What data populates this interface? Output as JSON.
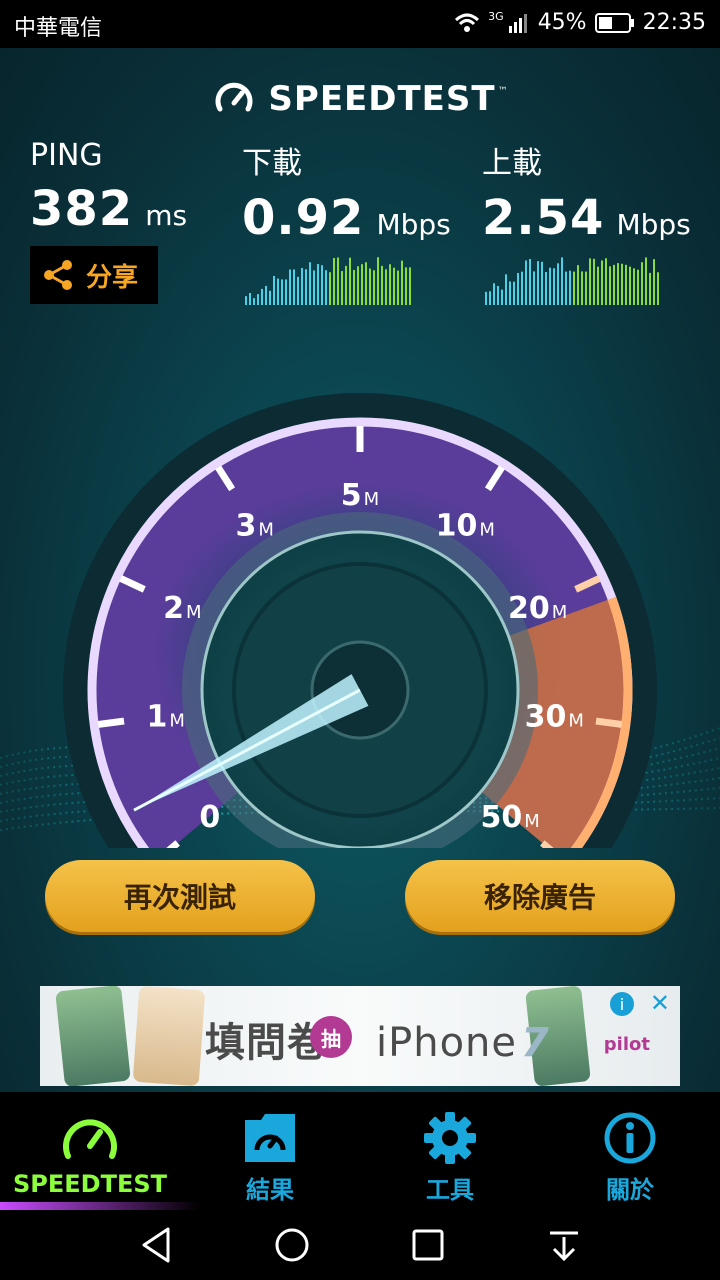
{
  "status_bar": {
    "carrier": "中華電信",
    "network": "3G",
    "battery": "45%",
    "time": "22:35"
  },
  "header": {
    "title": "SPEEDTEST",
    "tm": "™"
  },
  "metrics": {
    "ping": {
      "label": "PING",
      "value": "382",
      "unit": "ms"
    },
    "download": {
      "label": "下載",
      "value": "0.92",
      "unit": "Mbps"
    },
    "upload": {
      "label": "上載",
      "value": "2.54",
      "unit": "Mbps"
    }
  },
  "share": {
    "label": "分享"
  },
  "gauge": {
    "ticks": [
      {
        "num": "0",
        "suffix": ""
      },
      {
        "num": "1",
        "suffix": "M"
      },
      {
        "num": "2",
        "suffix": "M"
      },
      {
        "num": "3",
        "suffix": "M"
      },
      {
        "num": "5",
        "suffix": "M"
      },
      {
        "num": "10",
        "suffix": "M"
      },
      {
        "num": "20",
        "suffix": "M"
      },
      {
        "num": "30",
        "suffix": "M"
      },
      {
        "num": "50",
        "suffix": "M"
      }
    ],
    "colors": {
      "ring": "#e9d9ff",
      "arc_highlight": "#e07a33",
      "needle": "#bff3ff"
    }
  },
  "actions": {
    "retest": "再次測試",
    "remove_ads": "移除廣告"
  },
  "ad": {
    "text": "填問卷",
    "badge": "抽",
    "product": "iPhone",
    "model": "7",
    "brand": "pilot",
    "info": "i",
    "close": "✕"
  },
  "nav": [
    {
      "label": "SPEEDTEST",
      "icon": "gauge-icon"
    },
    {
      "label": "結果",
      "icon": "results-folder-icon"
    },
    {
      "label": "工具",
      "icon": "gear-icon"
    },
    {
      "label": "關於",
      "icon": "info-icon"
    }
  ]
}
